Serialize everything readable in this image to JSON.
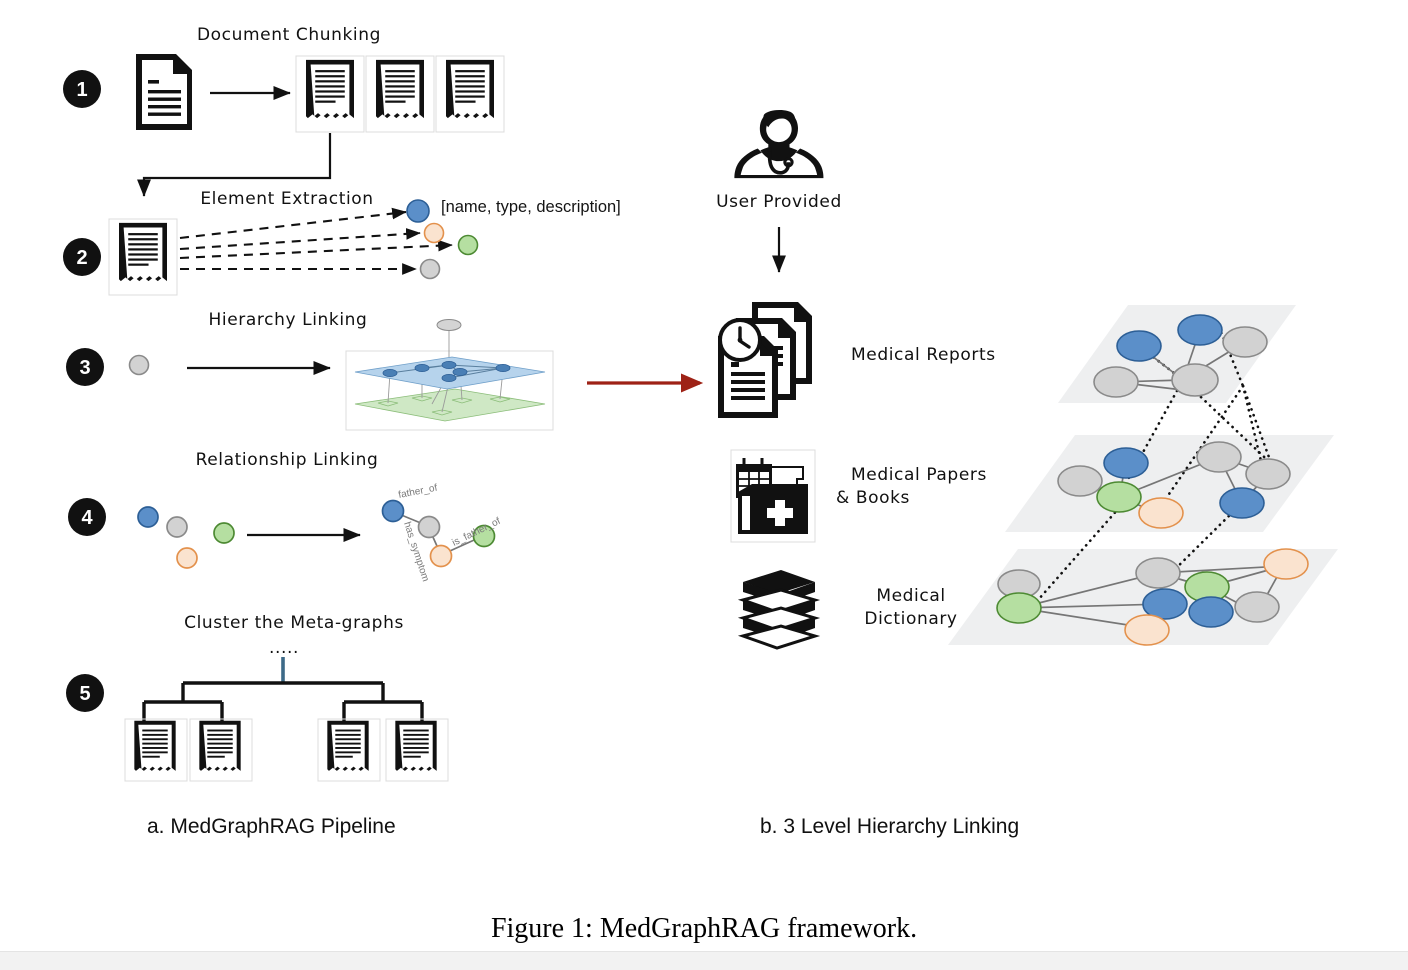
{
  "figure": {
    "caption": "Figure 1: MedGraphRAG framework.",
    "panel_a_caption": "a. MedGraphRAG Pipeline",
    "panel_b_caption": "b. 3 Level Hierarchy Linking"
  },
  "pipeline": {
    "steps": [
      {
        "number": "1",
        "title": "Document Chunking"
      },
      {
        "number": "2",
        "title": "Element Extraction",
        "annotation": "[name, type, description]"
      },
      {
        "number": "3",
        "title": "Hierarchy Linking"
      },
      {
        "number": "4",
        "title": "Relationship Linking"
      },
      {
        "number": "5",
        "title": "Cluster the Meta-graphs",
        "ellipsis": "....."
      }
    ],
    "relationship_labels": [
      "father_of",
      "has_symptom",
      "is_father_of"
    ]
  },
  "hierarchy": {
    "source_label": "User Provided",
    "levels": [
      {
        "label": "Medical Reports",
        "icon": "reports-clock-icon"
      },
      {
        "label": "Medical Papers\n& Books",
        "label_line1": "Medical Papers",
        "label_line2": "& Books",
        "icon": "medical-folder-icon"
      },
      {
        "label": "Medical\nDictionary",
        "label_line1": "Medical",
        "label_line2": "Dictionary",
        "icon": "books-stack-icon"
      }
    ]
  },
  "icons": {
    "doctor": "doctor-avatar-icon",
    "document": "document-icon",
    "chunk": "torn-document-icon",
    "down_arrow": "arrow-down-icon",
    "right_arrow": "arrow-right-icon",
    "red_arrow": "red-arrow-right-icon"
  },
  "colors": {
    "node_blue_fill": "#5b8fc9",
    "node_blue_stroke": "#2d5f96",
    "node_gray_fill": "#d2d2d2",
    "node_gray_stroke": "#8a8a8a",
    "node_green_fill": "#b5dfa1",
    "node_green_stroke": "#4d8a33",
    "node_peach_fill": "#fae3cf",
    "node_peach_stroke": "#e3914c",
    "plane_fill": "#eeeff0",
    "red_arrow": "#9e2216",
    "blue_plane": "#b6d3ec",
    "green_plane": "#cfe8c5",
    "tree_stem": "#3d6a88"
  },
  "chart_data": {
    "type": "diagram",
    "title": "MedGraphRAG framework",
    "panels": [
      {
        "id": "a",
        "title": "a. MedGraphRAG Pipeline",
        "steps": [
          {
            "n": 1,
            "label": "Document Chunking",
            "from": "document",
            "to": "3 chunks"
          },
          {
            "n": 2,
            "label": "Element Extraction",
            "from": "chunk",
            "to": "4 entity nodes",
            "entity_format": "[name, type, description]"
          },
          {
            "n": 3,
            "label": "Hierarchy Linking",
            "from": "single node",
            "to": "2-layer linked graph"
          },
          {
            "n": 4,
            "label": "Relationship Linking",
            "from": "4 loose nodes",
            "to": "connected meta-graph",
            "edges": [
              "father_of",
              "has_symptom",
              "is_father_of"
            ]
          },
          {
            "n": 5,
            "label": "Cluster the Meta-graphs",
            "to": "tree of 4 document clusters"
          }
        ]
      },
      {
        "id": "b",
        "title": "b. 3 Level Hierarchy Linking",
        "source": "User Provided",
        "levels": [
          {
            "index": 1,
            "label": "Medical Reports",
            "nodes": 5,
            "node_colors": [
              "blue",
              "blue",
              "gray",
              "gray",
              "gray"
            ]
          },
          {
            "index": 2,
            "label": "Medical Papers & Books",
            "nodes": 7,
            "node_colors": [
              "gray",
              "blue",
              "green",
              "peach",
              "gray",
              "gray",
              "blue"
            ]
          },
          {
            "index": 3,
            "label": "Medical Dictionary",
            "nodes": 9,
            "node_colors": [
              "gray",
              "green",
              "blue",
              "peach",
              "gray",
              "green",
              "blue",
              "gray",
              "peach"
            ]
          }
        ]
      }
    ]
  }
}
